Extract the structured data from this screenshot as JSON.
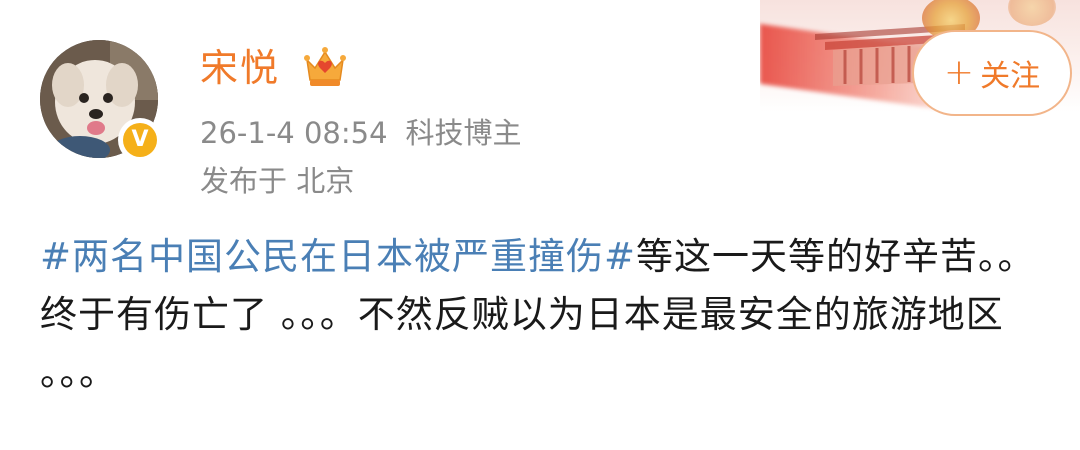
{
  "user": {
    "name": "宋悦",
    "verified_badge": "V",
    "crown_icon": "crown-icon",
    "avatar_icon": "dog-avatar"
  },
  "meta": {
    "timestamp": "26-1-4 08:54",
    "category": "科技博主",
    "location": "发布于 北京"
  },
  "follow_button": {
    "plus": "+",
    "label": "关注"
  },
  "post": {
    "hashtag": "#两名中国公民在日本被严重撞伤#",
    "text": "等这一天等的好辛苦。。终于有伤亡了 。。。不然反贼以为日本是最安全的旅游地区 。。。"
  },
  "colors": {
    "username": "#f07a2a",
    "hashtag": "#4a7fb5",
    "meta": "#8a8a8a",
    "follow_border": "#f2b58a",
    "verified": "#f5b019"
  }
}
